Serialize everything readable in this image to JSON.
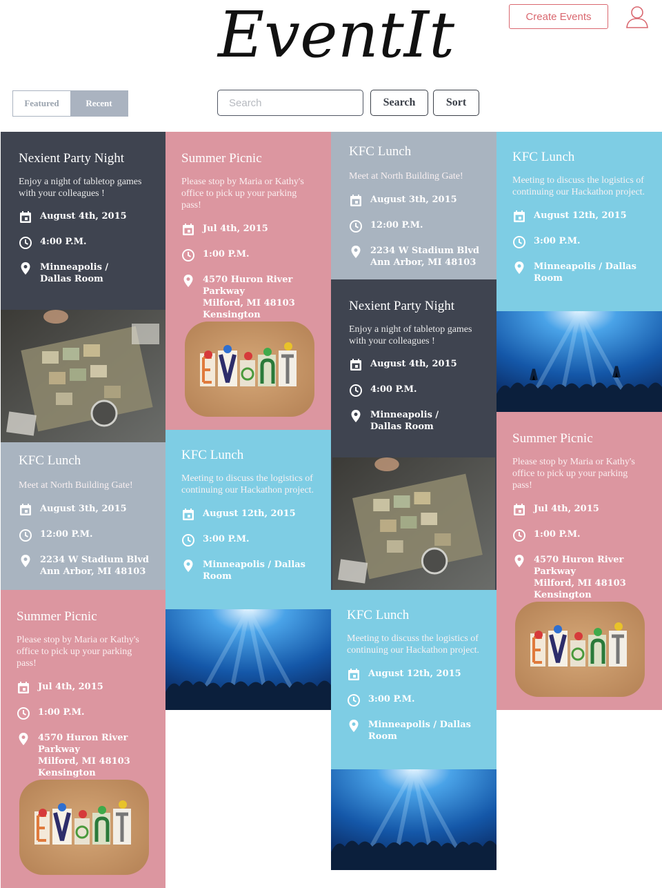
{
  "header": {
    "logo_text": "EventIt",
    "create_label": "Create Events"
  },
  "filters": {
    "featured_label": "Featured",
    "recent_label": "Recent"
  },
  "search": {
    "placeholder": "Search",
    "search_label": "Search",
    "sort_label": "Sort"
  },
  "cards": [
    {
      "title": "Nexient Party Night",
      "desc": "Enjoy a night of tabletop games with your colleagues !",
      "date": "August 4th, 2015",
      "time": "4:00 P.M.",
      "location": "Minneapolis /\nDallas Room"
    },
    {
      "title": "Summer Picnic",
      "desc": "Please stop by Maria or Kathy's office to pick up your parking pass!",
      "date": "Jul 4th, 2015",
      "time": "1:00 P.M.",
      "location": "4570 Huron River Parkway\nMilford, MI 48103\nKensington MetroPark"
    },
    {
      "title": "KFC Lunch",
      "desc": "Meet at North Building Gate!",
      "date": "August 3th, 2015",
      "time": "12:00 P.M.",
      "location": "2234  W Stadium Blvd\nAnn Arbor, MI 48103"
    },
    {
      "title": "KFC Lunch",
      "desc": "Meeting to discuss the logistics of continuing our Hackathon project.",
      "date": "August 12th, 2015",
      "time": "3:00 P.M.",
      "location": "Minneapolis / Dallas Room"
    },
    {
      "title": "Nexient Party Night",
      "desc": "Enjoy a night of tabletop games with your colleagues !",
      "date": "August 4th, 2015",
      "time": "4:00 P.M.",
      "location": "Minneapolis /\nDallas Room"
    },
    {
      "title": "KFC Lunch",
      "desc": "Meet at North Building Gate!",
      "date": "August 3th, 2015",
      "time": "12:00 P.M.",
      "location": "2234  W Stadium Blvd\nAnn Arbor, MI 48103"
    },
    {
      "title": "KFC Lunch",
      "desc": "Meeting to discuss the logistics of continuing our Hackathon project.",
      "date": "August 12th, 2015",
      "time": "3:00 P.M.",
      "location": "Minneapolis / Dallas Room"
    },
    {
      "title": "Summer Picnic",
      "desc": "Please stop by Maria or Kathy's office to pick up your parking pass!",
      "date": "Jul 4th, 2015",
      "time": "1:00 P.M.",
      "location": "4570 Huron River Parkway\nMilford, MI 48103\nKensington MetroPark"
    },
    {
      "title": "Summer Picnic",
      "desc": "Please stop by Maria or Kathy's office to pick up your parking pass!",
      "date": "Jul 4th, 2015",
      "time": "1:00 P.M.",
      "location": "4570 Huron River Parkway\nMilford, MI 48103\nKensington MetroPark"
    },
    {
      "title": "KFC Lunch",
      "desc": "Meeting to discuss the logistics of continuing our Hackathon project.",
      "date": "August 12th, 2015",
      "time": "3:00 P.M.",
      "location": "Minneapolis / Dallas Room"
    }
  ],
  "colors": {
    "dark": "#3f4450",
    "pink": "#dc96a0",
    "blue": "#7ecde4",
    "gray": "#a9b4c0",
    "accent": "#d9676f"
  },
  "icons": [
    "calendar-icon",
    "clock-icon",
    "location-pin-icon",
    "user-icon"
  ]
}
